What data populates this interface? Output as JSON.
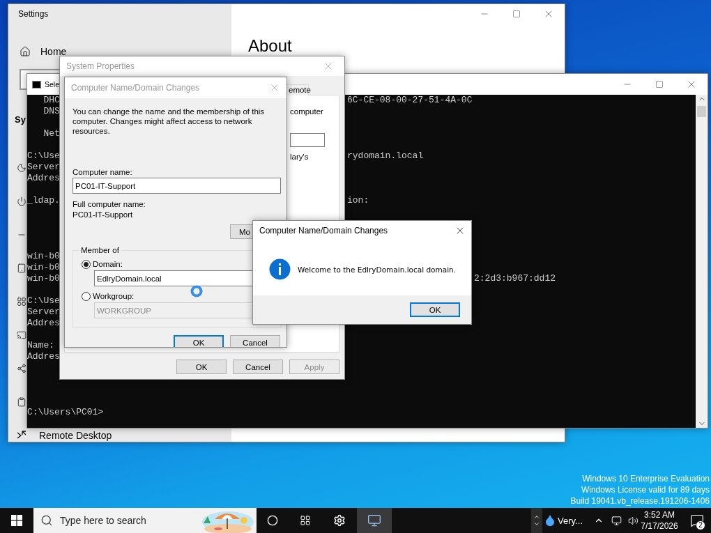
{
  "settings": {
    "title": "Settings",
    "home": "Home",
    "section_heading": "Sy",
    "page_heading": "About",
    "sidebar_items": [
      {
        "label": "Remote Desktop"
      }
    ]
  },
  "console": {
    "title": "Sele",
    "lines": [
      {
        "left": "   DHC",
        "right": "6C-CE-08-00-27-51-4A-0C"
      },
      {
        "left": "   DNS"
      },
      {
        "kind": "blank"
      },
      {
        "left": "   Net"
      },
      {
        "kind": "blank"
      },
      {
        "left": "C:\\Use",
        "right": "rydomain.local"
      },
      {
        "left": "Server"
      },
      {
        "left": "Addres"
      },
      {
        "kind": "blank"
      },
      {
        "left": "_ldap.",
        "right": "ion:"
      },
      {
        "kind": "blank"
      },
      {
        "kind": "blank"
      },
      {
        "kind": "blank"
      },
      {
        "kind": "blank"
      },
      {
        "left": "win-b0"
      },
      {
        "left": "win-b0"
      },
      {
        "left": "win-b0",
        "right": "2:2d3:b967:dd12",
        "kind": "past-dialog"
      },
      {
        "kind": "blank"
      },
      {
        "left": "C:\\Use"
      },
      {
        "left": "Server"
      },
      {
        "left": "Addres"
      },
      {
        "kind": "blank"
      },
      {
        "left": "Name:"
      },
      {
        "left": "Addres"
      },
      {
        "kind": "blank"
      },
      {
        "kind": "blank"
      },
      {
        "kind": "blank"
      },
      {
        "kind": "blank"
      },
      {
        "left": "C:\\Users\\PC01>"
      }
    ]
  },
  "system_properties": {
    "title": "System Properties",
    "tab": {
      "label": "emote",
      "selected": false
    },
    "panel_texts": [
      "computer",
      "lary's"
    ],
    "buttons": [
      {
        "label": "OK",
        "disabled": false
      },
      {
        "label": "Cancel",
        "disabled": false
      },
      {
        "label": "Apply",
        "disabled": true
      }
    ]
  },
  "name_dialog": {
    "title": "Computer Name/Domain Changes",
    "intro": "You can change the name and the membership of this computer. Changes might affect access to network resources.",
    "computer_name_label": "Computer name:",
    "computer_name": "PC01-IT-Support",
    "full_name_label": "Full computer name:",
    "full_name": "PC01-IT-Support",
    "more_button": "Mo",
    "member_of": "Member of",
    "options": [
      {
        "label": "Domain:",
        "selected": true,
        "value": "EdlryDomain.local"
      },
      {
        "label": "Workgroup:",
        "selected": false,
        "value": "WORKGROUP"
      }
    ],
    "buttons": [
      {
        "label": "OK",
        "focused": true
      },
      {
        "label": "Cancel",
        "focused": false
      }
    ]
  },
  "message_box": {
    "title": "Computer Name/Domain Changes",
    "message": "Welcome to the EdlryDomain.local domain.",
    "button": "OK"
  },
  "watermark": [
    "Windows 10 Enterprise Evaluation",
    "Windows License valid for 89 days",
    "Build 19041.vb_release.191206-1406"
  ],
  "taskbar": {
    "search_placeholder": "Type here to search",
    "tray_app": "Very...",
    "time": "3:52 AM",
    "date": "7/17/2026",
    "notifications": "2"
  }
}
